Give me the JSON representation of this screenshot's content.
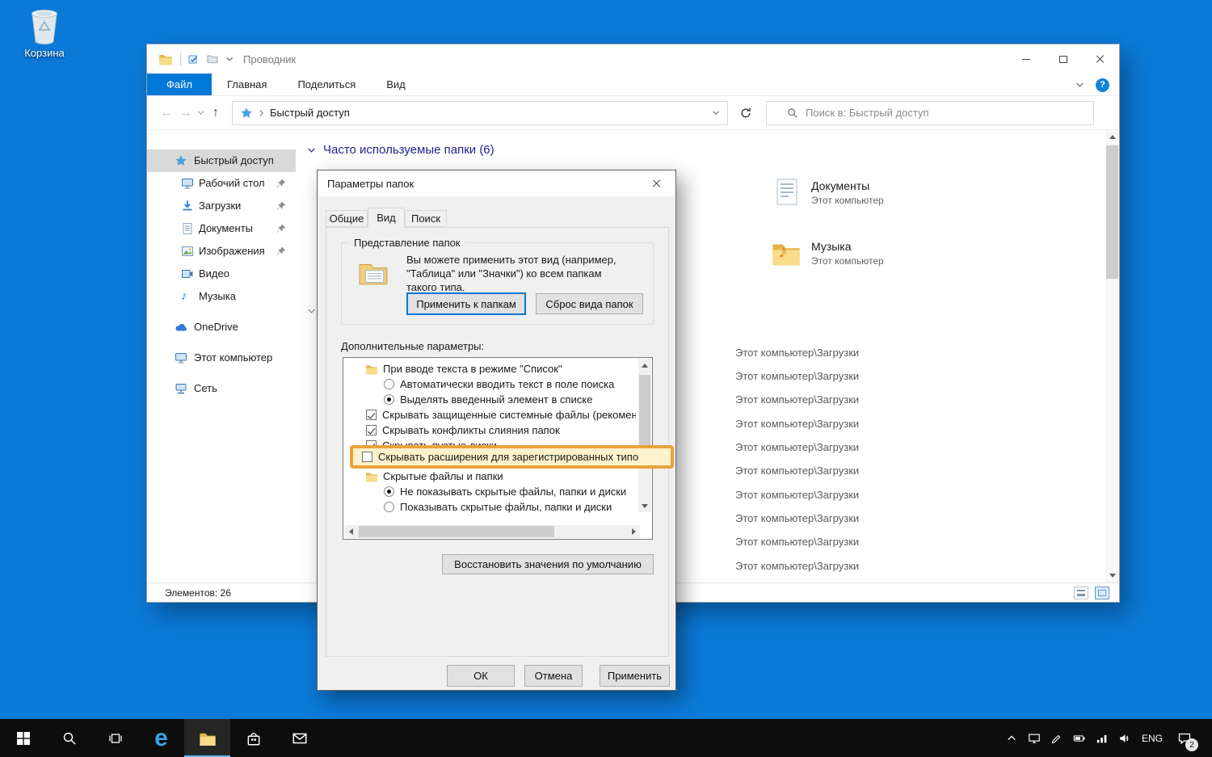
{
  "glyphs": {
    "back": "←",
    "forward": "→",
    "up": "↑",
    "music_note": "♪",
    "help": "?",
    "edge": "e"
  },
  "desktop": {
    "recycle_bin_label": "Корзина"
  },
  "explorer": {
    "title": "Проводник",
    "ribbon_tabs": [
      {
        "label": "Файл"
      },
      {
        "label": "Главная"
      },
      {
        "label": "Поделиться"
      },
      {
        "label": "Вид"
      }
    ],
    "address_path": "Быстрый доступ",
    "search_placeholder": "Поиск в: Быстрый доступ",
    "sidebar": {
      "items": [
        {
          "label": "Быстрый доступ"
        },
        {
          "label": "Рабочий стол"
        },
        {
          "label": "Загрузки"
        },
        {
          "label": "Документы"
        },
        {
          "label": "Изображения"
        },
        {
          "label": "Видео"
        },
        {
          "label": "Музыка"
        },
        {
          "label": "OneDrive"
        },
        {
          "label": "Этот компьютер"
        },
        {
          "label": "Сеть"
        }
      ]
    },
    "content": {
      "section_header": "Часто используемые папки (6)",
      "tiles": [
        {
          "name": "Документы",
          "location": "Этот компьютер"
        },
        {
          "name": "Музыка",
          "location": "Этот компьютер"
        }
      ],
      "recent_paths": [
        "Этот компьютер\\Загрузки",
        "Этот компьютер\\Загрузки",
        "Этот компьютер\\Загрузки",
        "Этот компьютер\\Загрузки",
        "Этот компьютер\\Загрузки",
        "Этот компьютер\\Загрузки",
        "Этот компьютер\\Загрузки",
        "Этот компьютер\\Загрузки",
        "Этот компьютер\\Загрузки",
        "Этот компьютер\\Загрузки"
      ]
    },
    "status": {
      "items_count": "Элементов: 26"
    }
  },
  "dialog": {
    "title": "Параметры папок",
    "tabs": [
      {
        "label": "Общие"
      },
      {
        "label": "Вид"
      },
      {
        "label": "Поиск"
      }
    ],
    "folder_view": {
      "group_title": "Представление папок",
      "desc1": "Вы можете применить этот вид (например,",
      "desc2": "\"Таблица\" или \"Значки\") ко всем папкам",
      "desc3": "такого типа.",
      "apply_to_folders": "Применить к папкам",
      "reset_folders": "Сброс вида папок"
    },
    "advanced_label": "Дополнительные параметры:",
    "advanced_items": [
      {
        "type": "folder",
        "label": "При вводе текста в режиме \"Список\""
      },
      {
        "type": "radio",
        "checked": false,
        "label": "Автоматически вводить текст в поле поиска"
      },
      {
        "type": "radio",
        "checked": true,
        "label": "Выделять введенный элемент в списке"
      },
      {
        "type": "checkbox",
        "checked": true,
        "label": "Скрывать защищенные системные файлы (рекоменд"
      },
      {
        "type": "checkbox",
        "checked": true,
        "label": "Скрывать конфликты слияния папок"
      },
      {
        "type": "checkbox",
        "checked": true,
        "label": "Скрывать пустые диски"
      },
      {
        "type": "checkbox",
        "checked": false,
        "highlighted": true,
        "label": "Скрывать расширения для зарегистрированных типо"
      },
      {
        "type": "folder",
        "label": "Скрытые файлы и папки"
      },
      {
        "type": "radio",
        "checked": true,
        "label": "Не показывать скрытые файлы, папки и диски"
      },
      {
        "type": "radio",
        "checked": false,
        "label": "Показывать скрытые файлы, папки и диски"
      }
    ],
    "restore_defaults": "Восстановить значения по умолчанию",
    "buttons": {
      "ok": "ОК",
      "cancel": "Отмена",
      "apply": "Применить"
    }
  },
  "taskbar": {
    "language": "ENG",
    "badge": "2"
  },
  "colors": {
    "desktop_bg": "#0b79d7",
    "accent": "#0078d7",
    "highlight_border": "#e9a33b"
  }
}
